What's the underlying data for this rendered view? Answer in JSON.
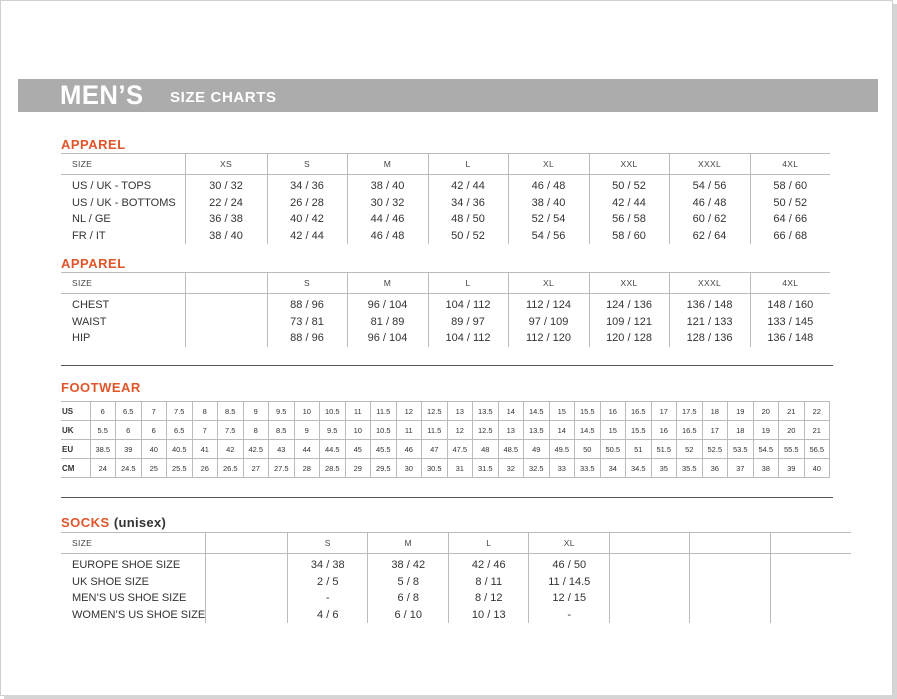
{
  "header": {
    "title_main": "MEN’S",
    "title_sub": "SIZE CHARTS"
  },
  "apparel_intl": {
    "title": "APPAREL",
    "columns": [
      "SIZE",
      "XS",
      "S",
      "M",
      "L",
      "XL",
      "XXL",
      "XXXL",
      "4XL"
    ],
    "rows": [
      [
        "US / UK - TOPS",
        "30 / 32",
        "34 / 36",
        "38 / 40",
        "42 / 44",
        "46 / 48",
        "50 / 52",
        "54 / 56",
        "58 / 60"
      ],
      [
        "US / UK - BOTTOMS",
        "22 / 24",
        "26 / 28",
        "30 / 32",
        "34 / 36",
        "38 / 40",
        "42 / 44",
        "46 / 48",
        "50 / 52"
      ],
      [
        "NL / GE",
        "36 / 38",
        "40 / 42",
        "44 / 46",
        "48 / 50",
        "52 / 54",
        "56 / 58",
        "60 / 62",
        "64 / 66"
      ],
      [
        "FR / IT",
        "38 / 40",
        "42 / 44",
        "46 / 48",
        "50 / 52",
        "54 / 56",
        "58 / 60",
        "62 / 64",
        "66 / 68"
      ]
    ]
  },
  "apparel_body": {
    "title": "APPAREL",
    "columns": [
      "SIZE",
      "",
      "S",
      "M",
      "L",
      "XL",
      "XXL",
      "XXXL",
      "4XL"
    ],
    "rows": [
      [
        "CHEST",
        "",
        "88 / 96",
        "96 / 104",
        "104 / 112",
        "112 / 124",
        "124 / 136",
        "136 / 148",
        "148 / 160"
      ],
      [
        "WAIST",
        "",
        "73 / 81",
        "81 / 89",
        "89 / 97",
        "97 / 109",
        "109 / 121",
        "121 / 133",
        "133 / 145"
      ],
      [
        "HIP",
        "",
        "88 / 96",
        "96 / 104",
        "104 / 112",
        "112 / 120",
        "120 / 128",
        "128 / 136",
        "136 / 148"
      ]
    ]
  },
  "footwear": {
    "title": "FOOTWEAR",
    "rows": [
      [
        "US",
        "6",
        "6.5",
        "7",
        "7.5",
        "8",
        "8.5",
        "9",
        "9.5",
        "10",
        "10.5",
        "11",
        "11.5",
        "12",
        "12.5",
        "13",
        "13.5",
        "14",
        "14.5",
        "15",
        "15.5",
        "16",
        "16.5",
        "17",
        "17.5",
        "18",
        "19",
        "20",
        "21",
        "22"
      ],
      [
        "UK",
        "5.5",
        "6",
        "6",
        "6.5",
        "7",
        "7.5",
        "8",
        "8.5",
        "9",
        "9.5",
        "10",
        "10.5",
        "11",
        "11.5",
        "12",
        "12.5",
        "13",
        "13.5",
        "14",
        "14.5",
        "15",
        "15.5",
        "16",
        "16.5",
        "17",
        "18",
        "19",
        "20",
        "21"
      ],
      [
        "EU",
        "38.5",
        "39",
        "40",
        "40.5",
        "41",
        "42",
        "42.5",
        "43",
        "44",
        "44.5",
        "45",
        "45.5",
        "46",
        "47",
        "47.5",
        "48",
        "48.5",
        "49",
        "49.5",
        "50",
        "50.5",
        "51",
        "51.5",
        "52",
        "52.5",
        "53.5",
        "54.5",
        "55.5",
        "56.5"
      ],
      [
        "CM",
        "24",
        "24.5",
        "25",
        "25.5",
        "26",
        "26.5",
        "27",
        "27.5",
        "28",
        "28.5",
        "29",
        "29.5",
        "30",
        "30.5",
        "31",
        "31.5",
        "32",
        "32.5",
        "33",
        "33.5",
        "34",
        "34.5",
        "35",
        "35.5",
        "36",
        "37",
        "38",
        "39",
        "40"
      ]
    ]
  },
  "socks": {
    "title": "SOCKS",
    "title_note": "(unisex)",
    "columns": [
      "SIZE",
      "",
      "S",
      "M",
      "L",
      "XL",
      "",
      "",
      ""
    ],
    "rows": [
      [
        "EUROPE SHOE SIZE",
        "",
        "34 / 38",
        "38 / 42",
        "42 / 46",
        "46 / 50",
        "",
        "",
        ""
      ],
      [
        "UK SHOE SIZE",
        "",
        "2 / 5",
        "5 / 8",
        "8 / 11",
        "11 / 14.5",
        "",
        "",
        ""
      ],
      [
        "MEN’S US SHOE SIZE",
        "",
        "-",
        "6 / 8",
        "8 / 12",
        "12 / 15",
        "",
        "",
        ""
      ],
      [
        "WOMEN’S US SHOE SIZE",
        "",
        "4 / 6",
        "6 / 10",
        "10 / 13",
        "-",
        "",
        "",
        ""
      ]
    ]
  },
  "colors": {
    "accent": "#e0552a",
    "banner": "#acacac",
    "rule": "#555555"
  }
}
